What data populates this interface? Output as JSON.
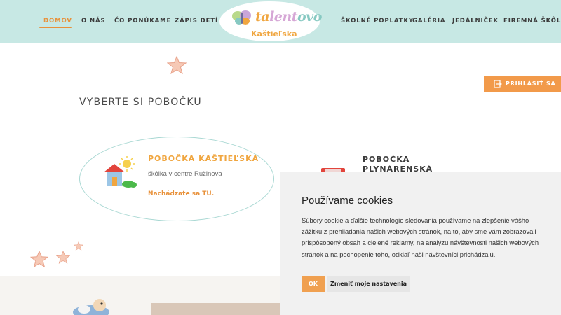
{
  "nav": {
    "left": [
      "DOMOV",
      "O NÁS",
      "ČO PONÚKAME",
      "ZÁPIS DETÍ"
    ],
    "right": [
      "ŠKOLNÉ POPLATKY",
      "GALÉRIA",
      "JEDÁLNIČEK",
      "FIREMNÁ ŠKÔLKA"
    ],
    "active": "DOMOV"
  },
  "logo": {
    "word_part1": "ta",
    "word_part2": "lent",
    "word_part3": "ovo",
    "subtitle": "Kaštieľska"
  },
  "login": {
    "label": "PRIHLÁSIŤ SA",
    "icon": "login-icon"
  },
  "section": {
    "title": "VYBERTE SI POBOČKU"
  },
  "branches": [
    {
      "title": "POBOČKA KAŠTIEĽSKA",
      "subtitle": "škôlka v centre Ružinova",
      "current": "Nachádzate sa TU.",
      "icon": "house-sun-icon"
    },
    {
      "title_line1": "POBOČKA",
      "title_line2": "PLYNÁRENSKÁ",
      "icon": "building-icon"
    }
  ],
  "cookies": {
    "title": "Používame cookies",
    "text": "Súbory cookie a ďalšie technológie sledovania používame na zlepšenie vášho zážitku z prehliadania našich webových stránok, na to, aby sme vám zobrazovali prispôsobený obsah a cielené reklamy, na analýzu návštevnosti našich webových stránok a na pochopenie toho, odkiaľ naši návštevníci prichádzajú.",
    "ok_label": "OK",
    "settings_label": "Zmeniť moje nastavenia"
  },
  "colors": {
    "header_bg": "#c7e8e4",
    "accent_orange": "#f0a640",
    "card_border": "#a9d8d3",
    "cookie_bg": "#f1f1f1"
  }
}
